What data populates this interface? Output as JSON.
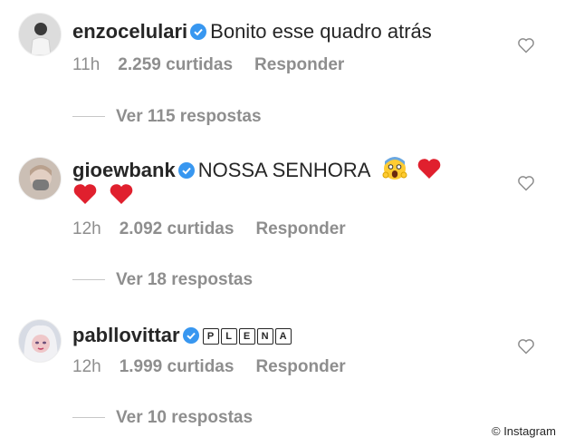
{
  "comments": [
    {
      "username": "enzocelulari",
      "text": "Bonito esse quadro atrás",
      "time": "11h",
      "likes": "2.259 curtidas",
      "reply_label": "Responder",
      "view_replies": "Ver 115 respostas",
      "avatar": "avatar-person-icon"
    },
    {
      "username": "gioewbank",
      "text": "NOSSA SENHORA",
      "emojis": [
        "screaming-face-emoji",
        "red-heart-emoji",
        "red-heart-emoji",
        "red-heart-emoji"
      ],
      "time": "12h",
      "likes": "2.092 curtidas",
      "reply_label": "Responder",
      "view_replies": "Ver 18 respostas",
      "avatar": "avatar-person-icon"
    },
    {
      "username": "pabllovittar",
      "text_boxed_letters": [
        "P",
        "L",
        "E",
        "N",
        "A"
      ],
      "time": "12h",
      "likes": "1.999 curtidas",
      "reply_label": "Responder",
      "view_replies": "Ver 10 respostas",
      "avatar": "avatar-person-icon"
    }
  ],
  "watermark": "© Instagram",
  "colors": {
    "text": "#262626",
    "muted": "#8e8e8e",
    "verified": "#3897f0",
    "heart": "#e0202e"
  }
}
